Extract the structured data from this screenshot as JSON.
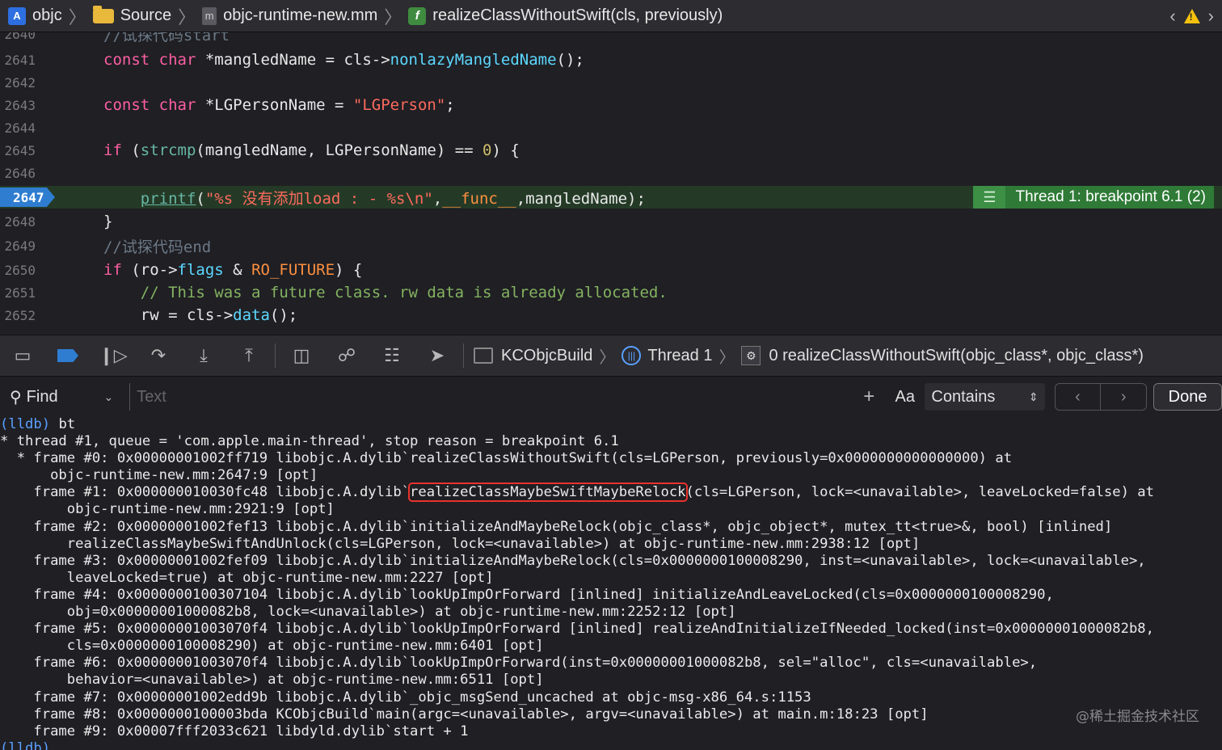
{
  "jumpbar": {
    "project": "objc",
    "folder": "Source",
    "file": "objc-runtime-new.mm",
    "function": "realizeClassWithoutSwift(cls, previously)",
    "icons": [
      "project-icon",
      "folder-icon",
      "mm-file-icon",
      "function-icon"
    ]
  },
  "editor": {
    "partial_top": "//试探代码start",
    "lines": [
      {
        "n": "2641"
      },
      {
        "n": "2642"
      },
      {
        "n": "2643"
      },
      {
        "n": "2644"
      },
      {
        "n": "2645"
      },
      {
        "n": "2646"
      },
      {
        "n": "2647"
      },
      {
        "n": "2648"
      },
      {
        "n": "2649"
      },
      {
        "n": "2650"
      },
      {
        "n": "2651"
      },
      {
        "n": "2652"
      }
    ],
    "breakpoint_line": "2647",
    "breakpoint_label": "Thread 1: breakpoint 6.1 (2)"
  },
  "debugbar": {
    "target": "KCObjcBuild",
    "thread": "Thread 1",
    "frame": "0 realizeClassWithoutSwift(objc_class*, objc_class*)"
  },
  "findbar": {
    "mode": "Find",
    "placeholder": "Text",
    "case_label": "Aa",
    "match_mode": "Contains",
    "done": "Done"
  },
  "console": {
    "prompt": "(lldb)",
    "command": "bt",
    "lines": [
      "* thread #1, queue = 'com.apple.main-thread', stop reason = breakpoint 6.1",
      "  * frame #0: 0x00000001002ff719 libobjc.A.dylib`realizeClassWithoutSwift(cls=LGPerson, previously=0x0000000000000000) at",
      "      objc-runtime-new.mm:2647:9 [opt]",
      "    frame #1: 0x000000010030fc48 libobjc.A.dylib`realizeClassMaybeSwiftMaybeRelock(cls=LGPerson, lock=<unavailable>, leaveLocked=false) at",
      "        objc-runtime-new.mm:2921:9 [opt]",
      "    frame #2: 0x00000001002fef13 libobjc.A.dylib`initializeAndMaybeRelock(objc_class*, objc_object*, mutex_tt<true>&, bool) [inlined]",
      "        realizeClassMaybeSwiftAndUnlock(cls=LGPerson, lock=<unavailable>) at objc-runtime-new.mm:2938:12 [opt]",
      "    frame #3: 0x00000001002fef09 libobjc.A.dylib`initializeAndMaybeRelock(cls=0x0000000100008290, inst=<unavailable>, lock=<unavailable>,",
      "        leaveLocked=true) at objc-runtime-new.mm:2227 [opt]",
      "    frame #4: 0x0000000100307104 libobjc.A.dylib`lookUpImpOrForward [inlined] initializeAndLeaveLocked(cls=0x0000000100008290,",
      "        obj=0x00000001000082b8, lock=<unavailable>) at objc-runtime-new.mm:2252:12 [opt]",
      "    frame #5: 0x00000001003070f4 libobjc.A.dylib`lookUpImpOrForward [inlined] realizeAndInitializeIfNeeded_locked(inst=0x00000001000082b8,",
      "        cls=0x0000000100008290) at objc-runtime-new.mm:6401 [opt]",
      "    frame #6: 0x00000001003070f4 libobjc.A.dylib`lookUpImpOrForward(inst=0x00000001000082b8, sel=\"alloc\", cls=<unavailable>,",
      "        behavior=<unavailable>) at objc-runtime-new.mm:6511 [opt]",
      "    frame #7: 0x00000001002edd9b libobjc.A.dylib`_objc_msgSend_uncached at objc-msg-x86_64.s:1153",
      "    frame #8: 0x0000000100003bda KCObjcBuild`main(argc=<unavailable>, argv=<unavailable>) at main.m:18:23 [opt]",
      "    frame #9: 0x00007fff2033c621 libdyld.dylib`start + 1"
    ],
    "frame1_prefix": "    frame #1: 0x000000010030fc48 libobjc.A.dylib`",
    "frame1_highlight": "realizeClassMaybeSwiftMaybeRelock",
    "frame1_suffix": "(cls=LGPerson, lock=<unavailable>, leaveLocked=false) at",
    "bottom_prompt": "(lldb)",
    "watermark": "@稀土掘金技术社区"
  },
  "colors": {
    "background": "#1f1f24",
    "keyword": "#fc5fa3",
    "string": "#fc6a5d",
    "breakpoint_blue": "#2f7dd1",
    "breakpoint_green": "#2e7a36",
    "highlight_red": "#e8332c"
  }
}
